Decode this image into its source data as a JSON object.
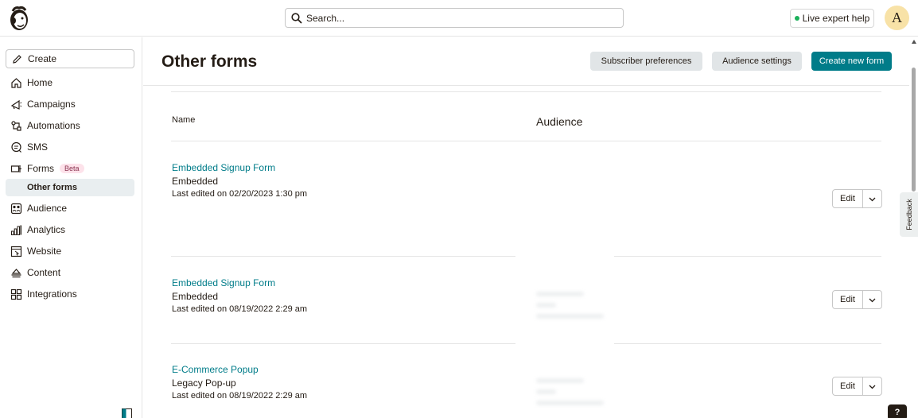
{
  "app": {
    "logo_icon": "mailchimp-freddie-icon",
    "accent_color": "#007c89"
  },
  "topbar": {
    "search_placeholder": "Search...",
    "live_help_label": "Live expert help",
    "avatar_initial": "A"
  },
  "sidebar": {
    "create_label": "Create",
    "items": [
      {
        "label": "Home",
        "icon": "home-icon"
      },
      {
        "label": "Campaigns",
        "icon": "megaphone-icon"
      },
      {
        "label": "Automations",
        "icon": "automations-icon"
      },
      {
        "label": "SMS",
        "icon": "sms-icon"
      },
      {
        "label": "Forms",
        "icon": "forms-icon",
        "badge": "Beta"
      },
      {
        "label": "Audience",
        "icon": "audience-icon"
      },
      {
        "label": "Analytics",
        "icon": "analytics-icon"
      },
      {
        "label": "Website",
        "icon": "website-icon"
      },
      {
        "label": "Content",
        "icon": "content-icon"
      },
      {
        "label": "Integrations",
        "icon": "integrations-icon"
      }
    ],
    "sub_active": "Other forms"
  },
  "main": {
    "title": "Other forms",
    "buttons": {
      "subscriber_preferences": "Subscriber preferences",
      "audience_settings": "Audience settings",
      "create_new_form": "Create new form"
    },
    "table": {
      "columns": {
        "name": "Name",
        "audience": "Audience"
      },
      "rows": [
        {
          "name": "Embedded Signup Form",
          "type": "Embedded",
          "edited": "Last edited on 02/20/2023 1:30 pm",
          "edit_label": "Edit"
        },
        {
          "name": "Embedded Signup Form",
          "type": "Embedded",
          "edited": "Last edited on 08/19/2022 2:29 am",
          "edit_label": "Edit"
        },
        {
          "name": "E-Commerce Popup",
          "type": "Legacy Pop-up",
          "edited": "Last edited on 08/19/2022 2:29 am",
          "edit_label": "Edit"
        }
      ]
    }
  },
  "feedback_label": "Feedback",
  "help_label": "?"
}
